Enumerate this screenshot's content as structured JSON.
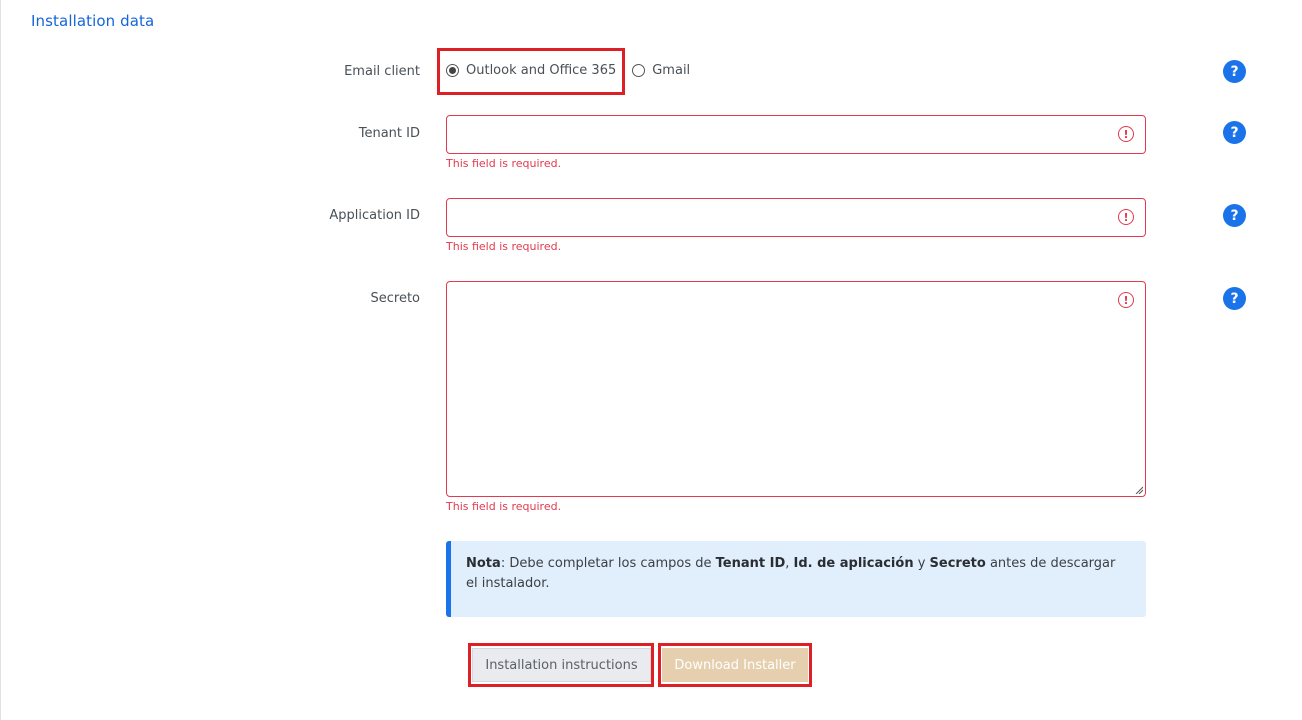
{
  "section": {
    "title": "Installation data"
  },
  "email_client": {
    "label": "Email client",
    "options": [
      {
        "label": "Outlook and Office 365",
        "checked": true
      },
      {
        "label": "Gmail",
        "checked": false
      }
    ]
  },
  "tenant": {
    "label": "Tenant ID",
    "value": "",
    "error": "This field is required."
  },
  "application": {
    "label": "Application ID",
    "value": "",
    "error": "This field is required."
  },
  "secret": {
    "label": "Secreto",
    "value": "",
    "error": "This field is required."
  },
  "icons": {
    "help": "?",
    "error": "!"
  },
  "note": {
    "bold1": "Nota",
    "text1": ": Debe completar los campos de ",
    "bold2": "Tenant ID",
    "text2": ", ",
    "bold3": "Id. de aplicación",
    "text3": " y ",
    "bold4": "Secreto",
    "text4": " antes de descargar el instalador."
  },
  "buttons": {
    "instructions": "Installation instructions",
    "download": "Download Installer"
  },
  "colors": {
    "accent": "#1a73e8",
    "error": "#e23a4e",
    "highlight": "#dd1f26",
    "download_disabled": "#e5cfae"
  }
}
